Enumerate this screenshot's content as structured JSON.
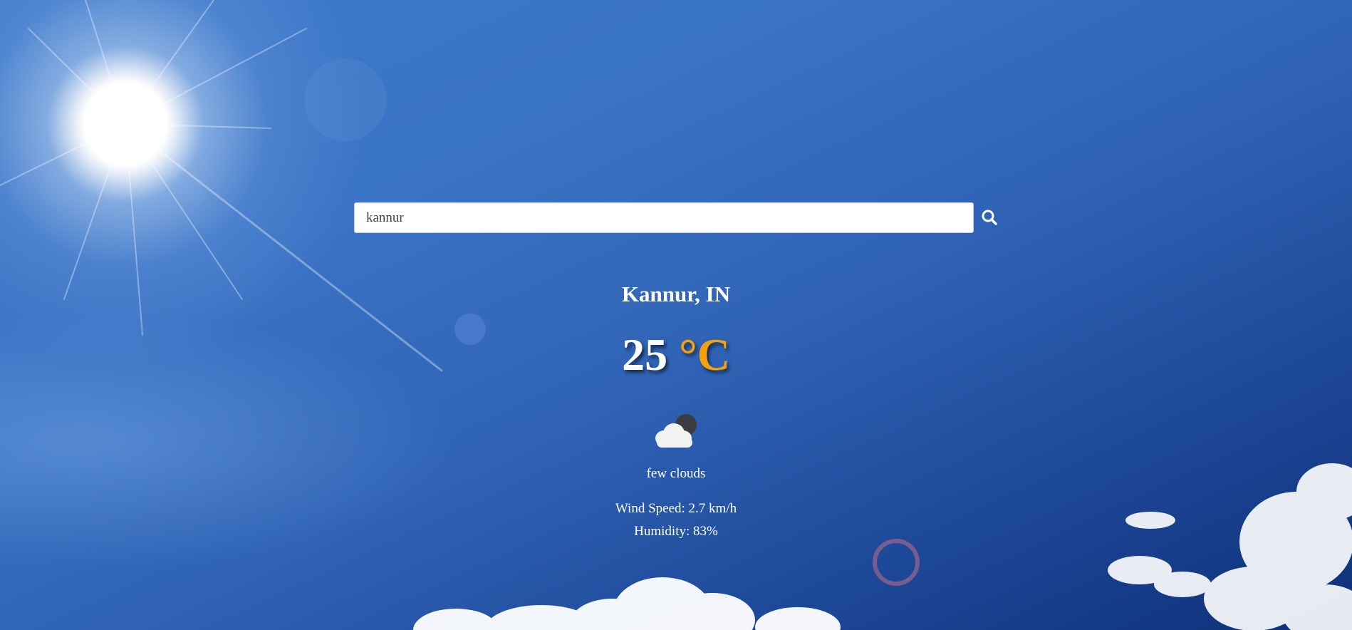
{
  "search": {
    "value": "kannur",
    "placeholder": "Search"
  },
  "weather": {
    "location": "Kannur, IN",
    "temperature": "25",
    "unit": "°C",
    "icon": "few-clouds-night-icon",
    "description": "few clouds",
    "wind_speed_label": "Wind Speed: 2.7 km/h",
    "humidity_label": "Humidity: 83%"
  },
  "colors": {
    "unit_accent": "#f5a00c",
    "sky_top_right": "#0e2f78",
    "sky_mid": "#3a73c5"
  }
}
